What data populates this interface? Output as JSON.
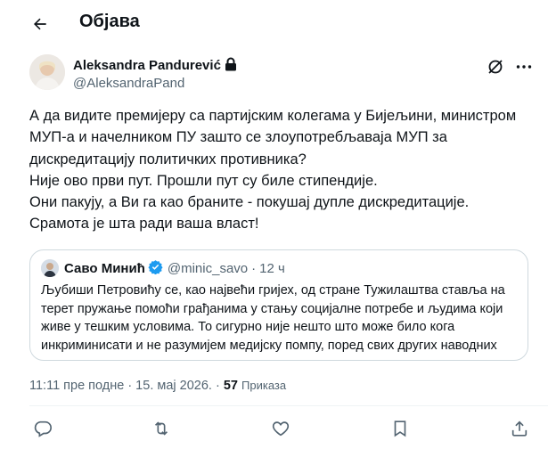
{
  "header": {
    "title": "Објава",
    "back_icon": "arrow-left-icon"
  },
  "author": {
    "name": "Aleksandra Pandurević",
    "handle": "@AleksandraPand",
    "protected_icon": "lock-icon",
    "grok_icon": "grok-icon"
  },
  "post": {
    "lines": [
      "А да видите премијеру са партијским колегама у Бијељини, министром",
      "МУП-а и начелником ПУ зашто се злоупотребљаваја МУП за",
      "дискредитацију политичких противника?",
      "Није ово први пут. Прошли пут су биле стипендије.",
      "Они пакују, а Ви га као браните - покушај дупле дискредитације.",
      "Срамота је шта ради ваша власт!"
    ]
  },
  "quote": {
    "name": "Саво Минић",
    "handle": "@minic_savo",
    "separator": "·",
    "time": "12 ч",
    "verified_color": "#1d9bf0",
    "lines": [
      "Љубиши Петровићу се, као највећи гријех, од стране Тужилаштва ставља на",
      "терет пружање помоћи грађанима у стању социјалне потребе и људима који",
      "живе у тешким условима. То сигурно није нешто што може било кога",
      "инкриминисати и не разумијем медијску помпу, поред свих других наводних"
    ]
  },
  "meta": {
    "timestamp": "11:11 пре подне · 15. мај 2026.",
    "separator": "·",
    "views_count": "57",
    "views_label": "Приказа"
  },
  "actions": [
    "reply-icon",
    "repost-icon",
    "like-icon",
    "bookmark-icon"
  ],
  "colors": {
    "text": "#0f1419",
    "secondary": "#536471",
    "border": "#cfd9de",
    "accent": "#1d9bf0"
  }
}
